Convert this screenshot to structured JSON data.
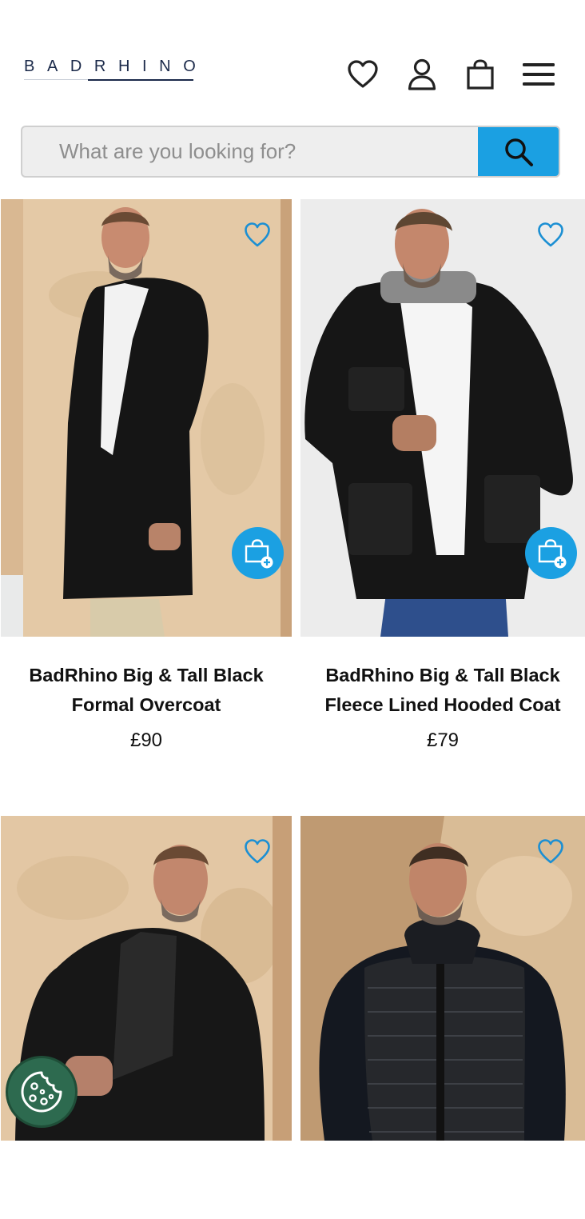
{
  "brand": {
    "logo_text": "BADRHINO"
  },
  "header": {
    "icons": [
      "wishlist-heart-icon",
      "account-user-icon",
      "shopping-bag-icon",
      "hamburger-menu-icon"
    ]
  },
  "search": {
    "placeholder": "What are you looking for?"
  },
  "colors": {
    "accent": "#1ba0e2",
    "brand_navy": "#1b2a4a",
    "cookie_green": "#2d6a4f"
  },
  "products": [
    {
      "title": "BadRhino Big & Tall Black Formal Overcoat",
      "price": "£90"
    },
    {
      "title": "BadRhino Big & Tall Black Fleece Lined Hooded Coat",
      "price": "£79"
    },
    {
      "title": "",
      "price": ""
    },
    {
      "title": "",
      "price": ""
    }
  ]
}
